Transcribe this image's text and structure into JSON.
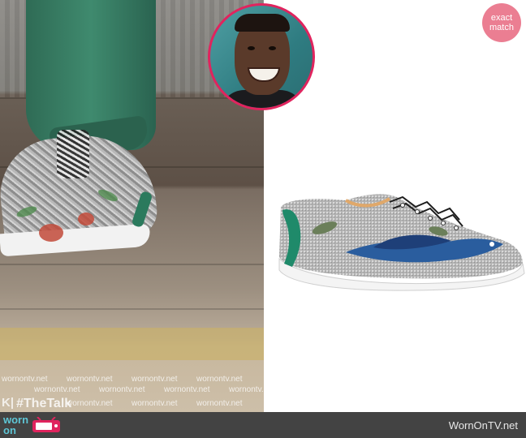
{
  "badge": {
    "line1": "exact",
    "line2": "match"
  },
  "left_photo": {
    "watermark": "wornontv.net",
    "hashtag": "#TheTalk",
    "network_mark": "K|"
  },
  "footer": {
    "logo_line1": "worn",
    "logo_line2": "on tv",
    "site": "WornOnTV.net"
  },
  "colors": {
    "badge": "#eb7e92",
    "portrait_ring": "#e0245e",
    "footer_bg": "#434343",
    "logo": "#5ec6d6",
    "shoe_accent": "#1f8a6a",
    "bird": "#2a5d9e"
  }
}
